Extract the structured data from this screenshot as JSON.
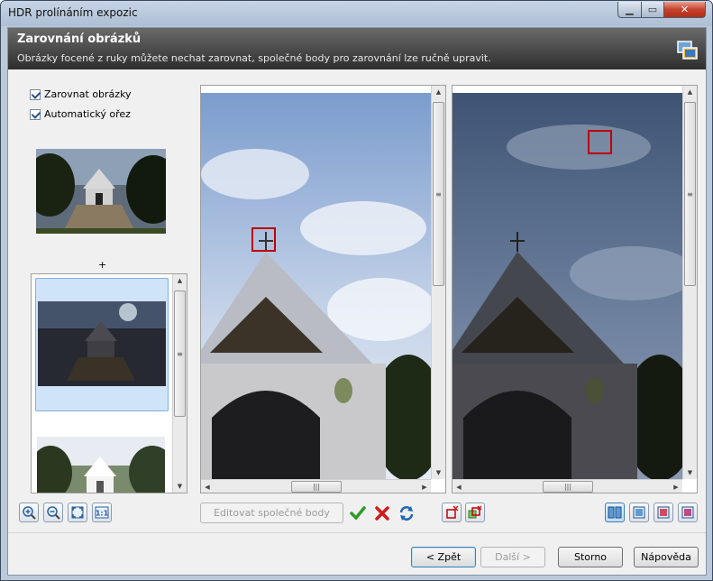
{
  "window": {
    "title": "HDR prolínáním expozic",
    "controls": [
      "minimize-icon",
      "maximize-icon",
      "close-icon"
    ]
  },
  "header": {
    "title": "Zarovnání obrázků",
    "subtitle": "Obrázky focené z ruky můžete nechat zarovnat, společné body pro zarovnání lze ručně upravit."
  },
  "options": {
    "align_label": "Zarovnat obrázky",
    "align_checked": true,
    "autocrop_label": "Automatický ořez",
    "autocrop_checked": true
  },
  "thumbnails": {
    "plus": "+",
    "items": [
      "base-exposure",
      "dark-exposure-selected",
      "bright-exposure"
    ]
  },
  "zoom_tools": [
    "zoom-in-icon",
    "zoom-out-icon",
    "fit-icon",
    "actual-size-icon"
  ],
  "points": {
    "edit_label": "Editovat společné body",
    "tools": [
      "confirm-icon",
      "delete-icon",
      "refresh-icon",
      "remove-point-icon",
      "remove-all-points-icon"
    ]
  },
  "view_modes": [
    "side-by-side-icon",
    "single-view-icon",
    "overlay-view-icon",
    "blend-view-icon"
  ],
  "footer": {
    "back": "< Zpět",
    "next": "Další >",
    "cancel": "Storno",
    "help": "Nápověda"
  },
  "colors": {
    "header_dark": "#2e2e2e",
    "marker": "#c00000",
    "selection": "#cfe3f9"
  }
}
